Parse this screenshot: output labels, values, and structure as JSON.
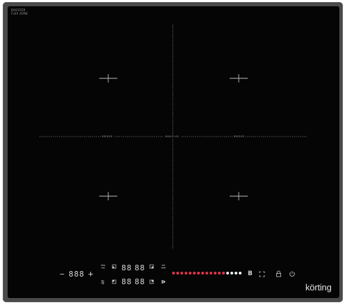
{
  "brand": {
    "logo_text": "körting",
    "model_line1": "BOOSTER",
    "model_line2": "FLEX ZONE"
  },
  "zones": {
    "left_bridge_label": "BRIDGE",
    "center_label": "MAXIFLEX",
    "right_bridge_label": "BRIDGE"
  },
  "controls": {
    "timer_minus": "−",
    "timer_display": "888",
    "timer_plus": "+",
    "zone_display_top_left": "88",
    "zone_display_top_right": "88",
    "zone_display_bottom_left": "88",
    "zone_display_bottom_right": "88",
    "boost_label": "B",
    "slider_red_count": "13",
    "slider_white_count": "4",
    "icons": [
      "zone-select-icon",
      "boost-icon",
      "flex-zone-icon",
      "lock-icon",
      "power-icon",
      "keep-warm-icon",
      "pause-icon"
    ]
  },
  "colors": {
    "glass": "#050505",
    "frame": "#4a4a4a",
    "slider_red": "#e0344a",
    "slider_white": "#f2f2f2"
  }
}
